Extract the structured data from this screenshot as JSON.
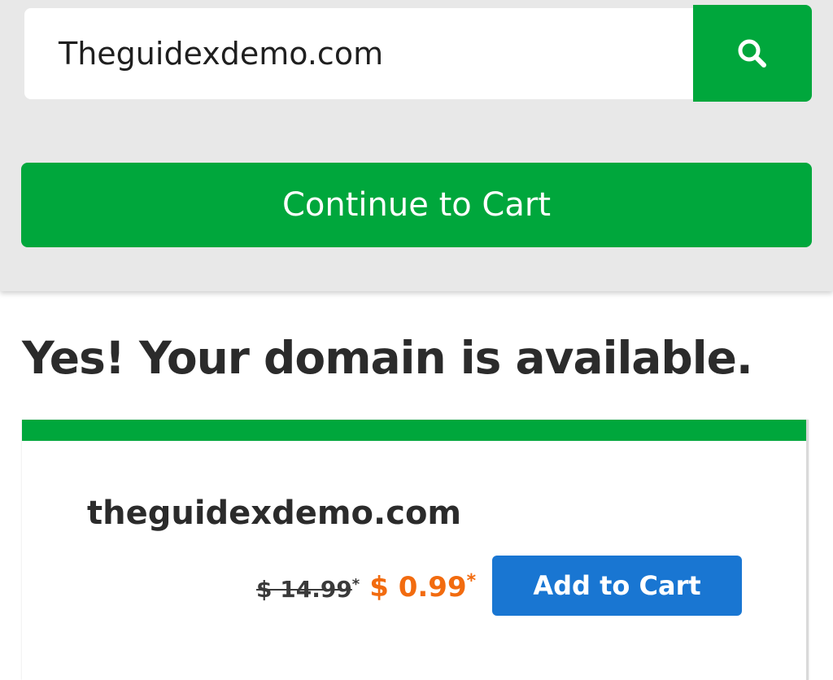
{
  "search": {
    "value": "Theguidexdemo.com",
    "button_icon": "search-icon"
  },
  "actions": {
    "continue_label": "Continue to Cart"
  },
  "result": {
    "headline": "Yes! Your domain is available.",
    "domain": "theguidexdemo.com",
    "old_price": "$ 14.99",
    "old_price_mark": "*",
    "new_price": "$ 0.99",
    "new_price_mark": "*",
    "add_label": "Add to Cart"
  },
  "colors": {
    "brand_green": "#00a73c",
    "price_orange": "#f26b0f",
    "button_blue": "#1976d2",
    "panel_gray": "#e8e8e8"
  }
}
